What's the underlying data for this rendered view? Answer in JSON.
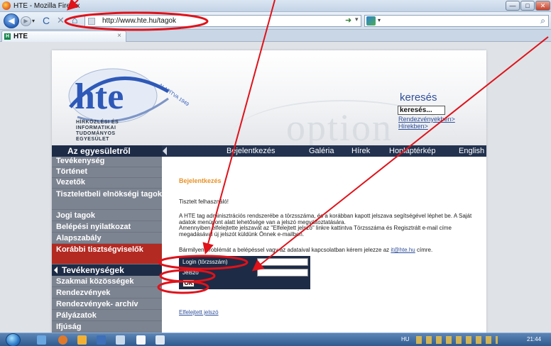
{
  "window": {
    "title": "HTE - Mozilla Firefox",
    "min_glyph": "—",
    "max_glyph": "□",
    "close_glyph": "✕"
  },
  "toolbar": {
    "back_glyph": "◀",
    "forward_glyph": "▶",
    "dropdown_glyph": "▾",
    "reload_glyph": "C",
    "stop_glyph": "✕",
    "home_glyph": "⌂",
    "url": "http://www.hte.hu/tagok",
    "go_glyph": "➜",
    "star_glyph": "▾",
    "search_glyph": "⌕"
  },
  "tabs": [
    {
      "label": "HTE",
      "favicon": "H",
      "close_glyph": "×"
    }
  ],
  "site": {
    "logo_text": "hte",
    "logo_arc_text": "ALAPÍTVA 1949",
    "logo_tagline": [
      "HÍRKÖZLÉSI ÉS",
      "INFORMATIKAI",
      "TUDOMÁNYOS",
      "EGYESÜLET"
    ],
    "banner_deco": "option",
    "search": {
      "title": "keresés",
      "input_value": "keresés...",
      "links": "Rendezvényekben> Hírekben>"
    },
    "topnav": {
      "sidebar_header": "Az egyesületről",
      "links": [
        "Bejelentkezés",
        "Galéria",
        "Hírek",
        "Honlaptérkép",
        "English"
      ]
    },
    "sidebar": {
      "items": [
        "Tevékenység",
        "Történet",
        "Vezetők",
        "Tiszteletbeli elnökségi tagok",
        "Jogi tagok",
        "Belépési nyilatkozat",
        "Alapszabály",
        "Korábbi tisztségviselők"
      ],
      "active_index": 7,
      "section2_title": "Tevékenységek",
      "items2": [
        "Szakmai közösségek",
        "Rendezvények",
        "Rendezvények- archív",
        "Pályázatok",
        "Ifjúság"
      ]
    },
    "content": {
      "heading": "Bejelentkezés",
      "greeting": "Tisztelt felhasználó!",
      "para1": "A HTE tag adminisztrációs rendszerébe a törzsszáma, és a korábban kapott jelszava segítségével léphet be. A Saját adatok menüpont alatt lehetősége van a jelszó megváltoztatására.",
      "para2": "Amennyiben elfelejtette jelszavát az \"Elfelejtett jelszó\" linkre kattintva Törzsszáma és Regisztrált e-mail címe megadásával új jelszót küldünk Önnek e-mailben.",
      "para3_prefix": "Bármilyen problémát a belépéssel vagy az adataival kapcsolatban kérem jelezze az ",
      "para3_email": "it@hte.hu",
      "para3_suffix": " címre.",
      "login_label": "Login (törzsszám)",
      "password_label": "Jelszó",
      "ok_label": "OK",
      "forgot_link": "Elfelejtett jelszó"
    }
  },
  "taskbar": {
    "lang": "HU",
    "clock": "21:44"
  },
  "colors": {
    "navy": "#1d2b46",
    "sidebar_gray": "#7d8491",
    "active_red": "#b32a22",
    "heading_orange": "#e79227",
    "link_blue": "#2f4f9a",
    "logo_blue": "#2e59b8",
    "annotation_red": "#e0121a"
  }
}
